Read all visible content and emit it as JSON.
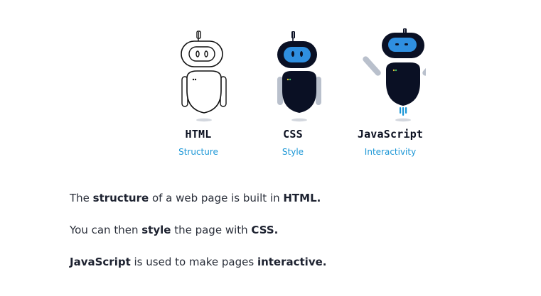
{
  "robots": [
    {
      "title": "HTML",
      "subtitle": "Structure"
    },
    {
      "title": "CSS",
      "subtitle": "Style"
    },
    {
      "title": "JavaScript",
      "subtitle": "Interactivity"
    }
  ],
  "colors": {
    "accent": "#1a96d6",
    "robot_dark": "#0a1024",
    "robot_blue": "#2f8fe0",
    "arm_gray": "#b9c0cc"
  },
  "lines": [
    {
      "p1": "The ",
      "b1": "structure",
      "p2": " of a web page is built in ",
      "b2": "HTML."
    },
    {
      "p1": "You can then ",
      "b1": "style",
      "p2": " the page with ",
      "b2": "CSS."
    },
    {
      "b1": "JavaScript",
      "p2": " is used to make pages ",
      "b2": "interactive."
    }
  ]
}
